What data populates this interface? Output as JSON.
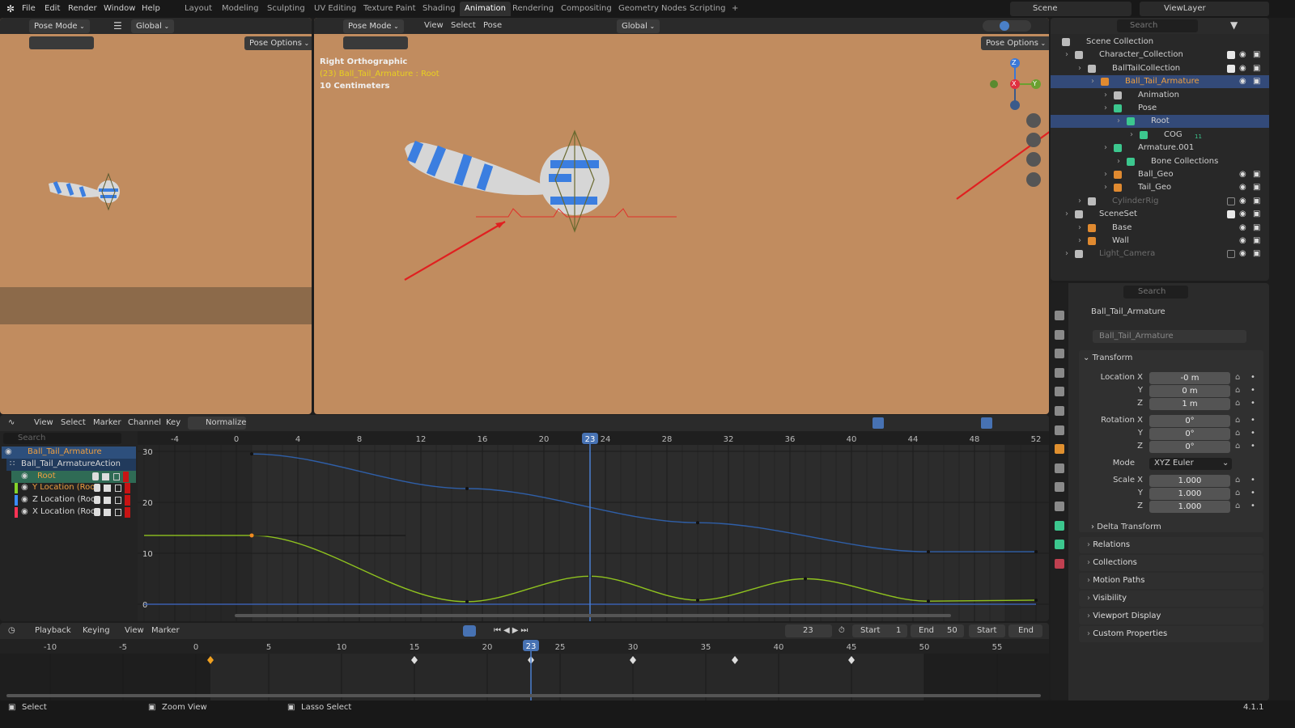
{
  "topbar": {
    "menus": [
      "File",
      "Edit",
      "Render",
      "Window",
      "Help"
    ],
    "workspaces": [
      "Layout",
      "Modeling",
      "Sculpting",
      "UV Editing",
      "Texture Paint",
      "Shading",
      "Animation",
      "Rendering",
      "Compositing",
      "Geometry Nodes",
      "Scripting",
      "+"
    ],
    "active_workspace": "Animation",
    "scene": "Scene",
    "view_layer": "ViewLayer"
  },
  "left_viewport": {
    "mode": "Pose Mode",
    "orientation": "Global",
    "pose_options": "Pose Options"
  },
  "main_viewport": {
    "mode": "Pose Mode",
    "menus": [
      "View",
      "Select",
      "Pose"
    ],
    "orientation": "Global",
    "pose_options": "Pose Options",
    "overlay_view": "Right Orthographic",
    "overlay_object": "(23) Ball_Tail_Armature : Root",
    "overlay_scale": "10 Centimeters",
    "gizmo_axes": [
      "Z",
      "X",
      "Y"
    ]
  },
  "outliner": {
    "search_placeholder": "Search",
    "rows": [
      {
        "label": "Scene Collection",
        "depth": 0,
        "icon": "collection-icon",
        "color": "#d0d0d0"
      },
      {
        "label": "Character_Collection",
        "depth": 1,
        "icon": "collection-icon",
        "color": "#d0d0d0",
        "checkbox": true,
        "eye": true
      },
      {
        "label": "BallTailCollection",
        "depth": 2,
        "icon": "collection-icon",
        "color": "#d0d0d0",
        "checkbox": true,
        "eye": true
      },
      {
        "label": "Ball_Tail_Armature",
        "depth": 3,
        "icon": "armature-icon",
        "color": "#f0a040",
        "selected": true,
        "eye": true
      },
      {
        "label": "Animation",
        "depth": 4,
        "icon": "animation-icon",
        "color": "#d0d0d0"
      },
      {
        "label": "Pose",
        "depth": 4,
        "icon": "pose-icon",
        "color": "#d0d0d0"
      },
      {
        "label": "Root",
        "depth": 5,
        "icon": "bone-icon",
        "color": "#d0d0d0",
        "selected": true
      },
      {
        "label": "COG",
        "depth": 6,
        "icon": "bone-icon",
        "color": "#d0d0d0"
      },
      {
        "label": "Armature.001",
        "depth": 4,
        "icon": "armature-data-icon",
        "color": "#d0d0d0"
      },
      {
        "label": "Bone Collections",
        "depth": 5,
        "icon": "bone-collections-icon",
        "color": "#d0d0d0"
      },
      {
        "label": "Ball_Geo",
        "depth": 4,
        "icon": "mesh-icon",
        "color": "#d0d0d0",
        "eye": true
      },
      {
        "label": "Tail_Geo",
        "depth": 4,
        "icon": "mesh-icon",
        "color": "#d0d0d0",
        "eye": true
      },
      {
        "label": "CylinderRig",
        "depth": 2,
        "icon": "collection-icon",
        "color": "#6c6c6c",
        "checkbox": false,
        "eye": true
      },
      {
        "label": "SceneSet",
        "depth": 1,
        "icon": "collection-icon",
        "color": "#d0d0d0",
        "checkbox": true,
        "eye": true
      },
      {
        "label": "Base",
        "depth": 2,
        "icon": "mesh-icon",
        "color": "#d0d0d0",
        "eye": true
      },
      {
        "label": "Wall",
        "depth": 2,
        "icon": "mesh-icon",
        "color": "#d0d0d0",
        "eye": true
      },
      {
        "label": "Light_Camera",
        "depth": 1,
        "icon": "collection-icon",
        "color": "#6c6c6c",
        "checkbox": false,
        "eye": true
      }
    ],
    "cog_badge": "11"
  },
  "properties": {
    "search_placeholder": "Search",
    "object_name": "Ball_Tail_Armature",
    "object_field": "Ball_Tail_Armature",
    "transform_title": "Transform",
    "fields": [
      {
        "label": "Location X",
        "value": "-0 m"
      },
      {
        "label": "Y",
        "value": "0 m"
      },
      {
        "label": "Z",
        "value": "1 m"
      },
      {
        "label": "Rotation X",
        "value": "0°"
      },
      {
        "label": "Y",
        "value": "0°"
      },
      {
        "label": "Z",
        "value": "0°"
      },
      {
        "label": "Scale X",
        "value": "1.000"
      },
      {
        "label": "Y",
        "value": "1.000"
      },
      {
        "label": "Z",
        "value": "1.000"
      }
    ],
    "mode_label": "Mode",
    "mode_value": "XYZ Euler",
    "delta": "Delta Transform",
    "panels": [
      "Relations",
      "Collections",
      "Motion Paths",
      "Visibility",
      "Viewport Display",
      "Custom Properties"
    ]
  },
  "graph_editor": {
    "menus": [
      "View",
      "Select",
      "Marker",
      "Channel",
      "Key"
    ],
    "normalize": "Normalize",
    "search_placeholder": "Search",
    "channels": [
      {
        "label": "Ball_Tail_Armature",
        "color": "#f0a040",
        "bg": "#2d4f7c"
      },
      {
        "label": "Ball_Tail_ArmatureAction",
        "color": "#d8d8d8",
        "bg": "#213a5c"
      },
      {
        "label": "Root",
        "color": "#f0a040",
        "bg": "#2f6b55"
      },
      {
        "label": "Y Location (Root)",
        "color": "#f0a040",
        "swatch": "#84d42a"
      },
      {
        "label": "Z Location (Root)",
        "color": "#d8d8d8",
        "swatch": "#3a8cff"
      },
      {
        "label": "X Location (Root)",
        "color": "#d8d8d8",
        "swatch": "#ff3355"
      }
    ],
    "frame_ticks": [
      -4,
      0,
      4,
      8,
      12,
      16,
      20,
      24,
      28,
      32,
      36,
      40,
      44,
      48,
      52
    ],
    "value_ticks": [
      0,
      10,
      20,
      30
    ],
    "current_frame": 23,
    "curves": [
      {
        "name": "Y Location (Root)",
        "color": "#8fc21f",
        "keys": [
          [
            1,
            13.5
          ],
          [
            15,
            0.5
          ],
          [
            23,
            5.5
          ],
          [
            30,
            0.8
          ],
          [
            37,
            5
          ],
          [
            45,
            0.6
          ],
          [
            52,
            0.8
          ]
        ]
      },
      {
        "name": "Z Location (Root)",
        "color": "#2f5fa8",
        "keys": [
          [
            1,
            29.5
          ],
          [
            15,
            22.7
          ],
          [
            30,
            16
          ],
          [
            45,
            10.3
          ],
          [
            52,
            10.3
          ]
        ]
      },
      {
        "name": "X Location (Root)",
        "color": "#3a5fae",
        "keys": [
          [
            -6,
            0
          ],
          [
            52,
            0
          ]
        ]
      }
    ]
  },
  "timeline": {
    "menus": [
      "Playback",
      "Keying",
      "View",
      "Marker"
    ],
    "current_frame": "23",
    "start_label": "Start",
    "start_value": "1",
    "end_label": "End",
    "end_value": "50",
    "jump_start": "Start",
    "jump_end": "End",
    "frame_ticks": [
      -10,
      -5,
      0,
      5,
      10,
      15,
      20,
      25,
      30,
      35,
      40,
      45,
      50,
      55
    ],
    "keyframes": [
      1,
      15,
      23,
      30,
      37,
      45
    ]
  },
  "statusbar": {
    "select": "Select",
    "zoom": "Zoom View",
    "lasso": "Lasso Select",
    "version": "4.1.1"
  }
}
